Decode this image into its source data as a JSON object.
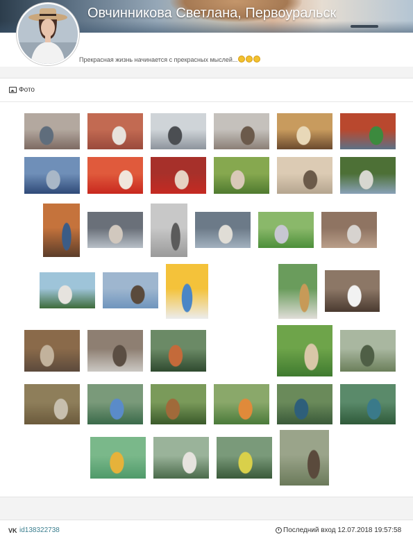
{
  "profile": {
    "name": "Овчинникова Светлана, Первоуральск",
    "status": "Прекрасная жизнь начинается с прекрасных мыслей...",
    "status_emoji_count": 3
  },
  "photos_section": {
    "title": "Фото",
    "icon": "photo-icon",
    "photo_count": 40
  },
  "footer": {
    "network_icon": "vk-icon",
    "user_id": "id138322738",
    "last_seen": "Последний вход 12.07.2018 19:57:58",
    "clock_icon": "clock-icon"
  },
  "colors": {
    "link": "#3a7e8e",
    "page_bg": "#f3f3f3"
  }
}
